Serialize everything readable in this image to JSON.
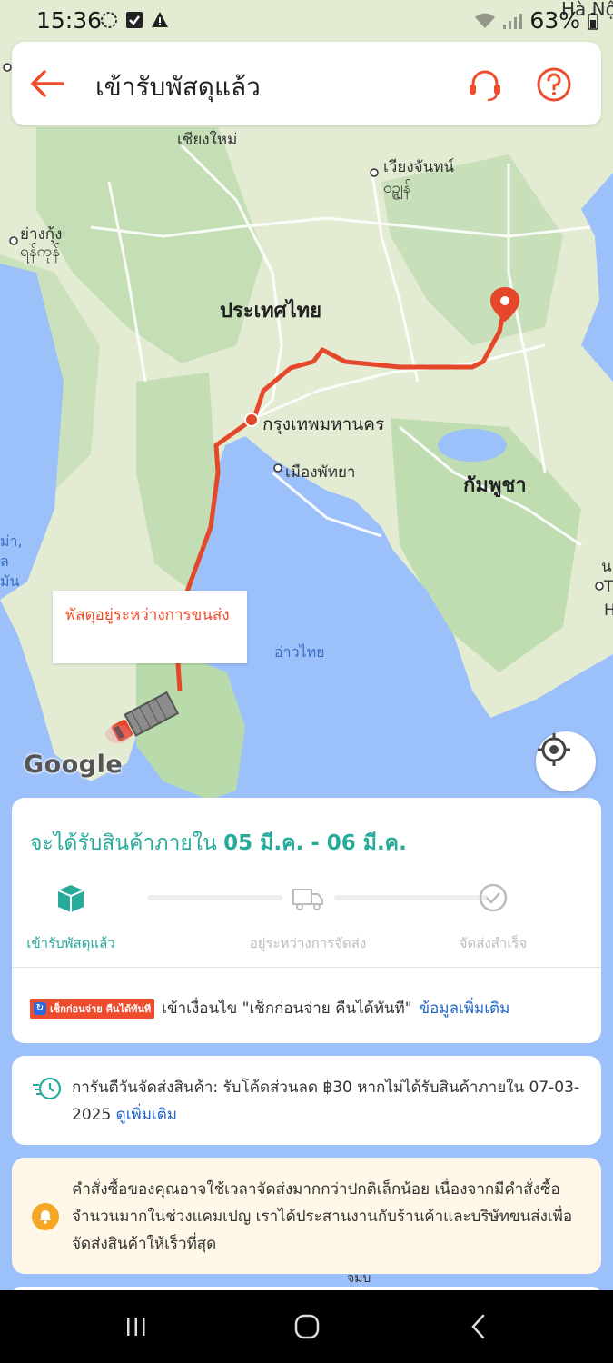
{
  "status": {
    "time": "15:36",
    "battery": "63%",
    "icons": [
      "sync-icon",
      "check-box-icon",
      "warning-icon",
      "wifi-icon",
      "signal-icon",
      "battery-icon"
    ]
  },
  "header": {
    "title": "เข้ารับพัสดุแล้ว",
    "back_icon": "arrow-left-icon",
    "support_icon": "headset-icon",
    "help_icon": "question-circle-icon"
  },
  "map": {
    "labels": {
      "country_thailand": "ประเทศไทย",
      "country_cambodia": "กัมพูชา",
      "bangkok": "กรุงเทพมหานคร",
      "chiang_mai": "เชียงใหม่",
      "vientiane_1": "เวียงจันทน์",
      "vientiane_2": "ဝဥ္ဂျန်",
      "yangon_1": "ย่างกุ้ง",
      "yangon_2": "ရန်ကုန်",
      "pattaya": "เมืองพัทยา",
      "gulf": "อ่าวไทย",
      "hanoi": "Hà Nộ",
      "left_edge_1": "ม่า,",
      "left_edge_2": "ล",
      "left_edge_3": "มัน",
      "right_edge_1": "น",
      "right_edge_2": "T",
      "right_edge_3": "H",
      "bottom": "จมบ"
    },
    "callout": "พัสดุอยู่ระหว่างการขนส่ง",
    "google_logo": "Google",
    "locate_icon": "crosshair-icon"
  },
  "delivery": {
    "eta_prefix": "จะได้รับสินค้าภายใน",
    "eta_range": "05 มี.ค. - 06 มี.ค.",
    "steps": [
      {
        "label": "เข้ารับพัสดุแล้ว",
        "icon": "package-icon",
        "active": true
      },
      {
        "label": "อยู่ระหว่างการจัดส่ง",
        "icon": "truck-icon",
        "active": false
      },
      {
        "label": "จัดส่งสำเร็จ",
        "icon": "check-circle-icon",
        "active": false
      }
    ],
    "promo_badge": "เช็กก่อนจ่าย คืนได้ทันที",
    "promo_text": "เข้าเงื่อนไข \"เช็กก่อนจ่าย คืนได้ทันที\"",
    "promo_link": "ข้อมูลเพิ่มเติม"
  },
  "guarantee": {
    "icon": "fast-clock-icon",
    "text": "การันตีวันจัดส่งสินค้า: รับโค้ดส่วนลด ฿30 หากไม่ได้รับสินค้าภายใน 07-03-2025",
    "link": "ดูเพิ่มเติม"
  },
  "notice": {
    "icon": "bell-icon",
    "text": "คำสั่งซื้อของคุณอาจใช้เวลาจัดส่งมากกว่าปกติเล็กน้อย เนื่องจากมีคำสั่งซื้อจำนวนมากในช่วงแคมเปญ เราได้ประสานงานกับร้านค้าและบริษัทขนส่งเพื่อจัดส่งสินค้าให้เร็วที่สุด"
  },
  "colors": {
    "accent": "#ee4d2d",
    "teal": "#26aa99",
    "link": "#1f64c8",
    "water": "#9cc0f9",
    "land": "#e8eedb"
  }
}
